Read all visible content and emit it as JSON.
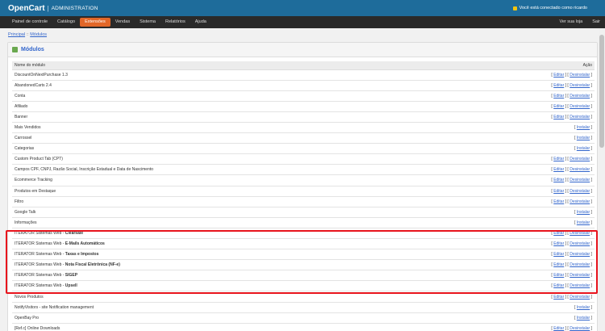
{
  "header": {
    "logo": "OpenCart",
    "sep": "|",
    "subtitle": "ADMINISTRATION",
    "user_text": "Você está conectado como ricardo"
  },
  "menu": {
    "left": [
      {
        "label": "Painel de controle",
        "active": false
      },
      {
        "label": "Catálogo",
        "active": false
      },
      {
        "label": "Extensões",
        "active": true
      },
      {
        "label": "Vendas",
        "active": false
      },
      {
        "label": "Sistema",
        "active": false
      },
      {
        "label": "Relatórios",
        "active": false
      },
      {
        "label": "Ajuda",
        "active": false
      }
    ],
    "right": [
      "Ver sua loja",
      "Sair"
    ]
  },
  "breadcrumb": {
    "home": "Principal",
    "sep": "::",
    "current": "Módulos"
  },
  "box": {
    "title": "Módulos"
  },
  "table": {
    "col_name": "Nome do módulo",
    "col_action": "Ação",
    "rows": [
      {
        "name": "DiscountOnNextPurchase 1.3",
        "installed": true
      },
      {
        "name": "AbandonedCarts 2.4",
        "installed": true
      },
      {
        "name": "Conta",
        "installed": true
      },
      {
        "name": "Afiliado",
        "installed": true
      },
      {
        "name": "Banner",
        "installed": true
      },
      {
        "name": "Mais Vendidos",
        "installed": false
      },
      {
        "name": "Carrossel",
        "installed": false
      },
      {
        "name": "Categorias",
        "installed": false
      },
      {
        "name": "Custom Product Tab (CPT)",
        "installed": true
      },
      {
        "name": "Campos CPF, CNPJ, Razão Social, Inscrição Estadual e Data de Nascimento",
        "installed": true
      },
      {
        "name": "Ecommerce Tracking",
        "installed": true
      },
      {
        "name": "Produtos em Destaque",
        "installed": true
      },
      {
        "name": "Filtro",
        "installed": true
      },
      {
        "name": "Google Talk",
        "installed": false
      },
      {
        "name": "Informações",
        "installed": false
      },
      {
        "name": "ITERATOR Sistemas Web - ",
        "bold": "Clearsale",
        "installed": true
      },
      {
        "name": "ITERATOR Sistemas Web - ",
        "bold": "E-Mails Automáticos",
        "installed": true
      },
      {
        "name": "ITERATOR Sistemas Web - ",
        "bold": "Taxas e Impostos",
        "installed": true
      },
      {
        "name": "ITERATOR Sistemas Web - ",
        "bold": "Nota Fiscal Eletrônica (NF-e)",
        "installed": true
      },
      {
        "name": "ITERATOR Sistemas Web - ",
        "bold": "SIGEP",
        "installed": true
      },
      {
        "name": "ITERATOR Sistemas Web - ",
        "bold": "Upsell",
        "installed": true
      },
      {
        "name": "Novos Produtos",
        "installed": true
      },
      {
        "name": "NotifyVisitors - site Notification management",
        "installed": false
      },
      {
        "name": "OpenBay Pro",
        "installed": false
      },
      {
        "name": "[Ref.c] Online Downloads",
        "installed": true
      }
    ],
    "action_labels": {
      "edit": "Editar",
      "uninstall": "Desinstalar",
      "install": "Instalar",
      "open": "[ ",
      "sep": " ] [ ",
      "close": " ]"
    }
  },
  "colors": {
    "header": "#1e6c9b",
    "menu": "#2a2a2a",
    "active_tab": "#e26728",
    "highlight": "#e8141d",
    "link": "#3366cc"
  }
}
